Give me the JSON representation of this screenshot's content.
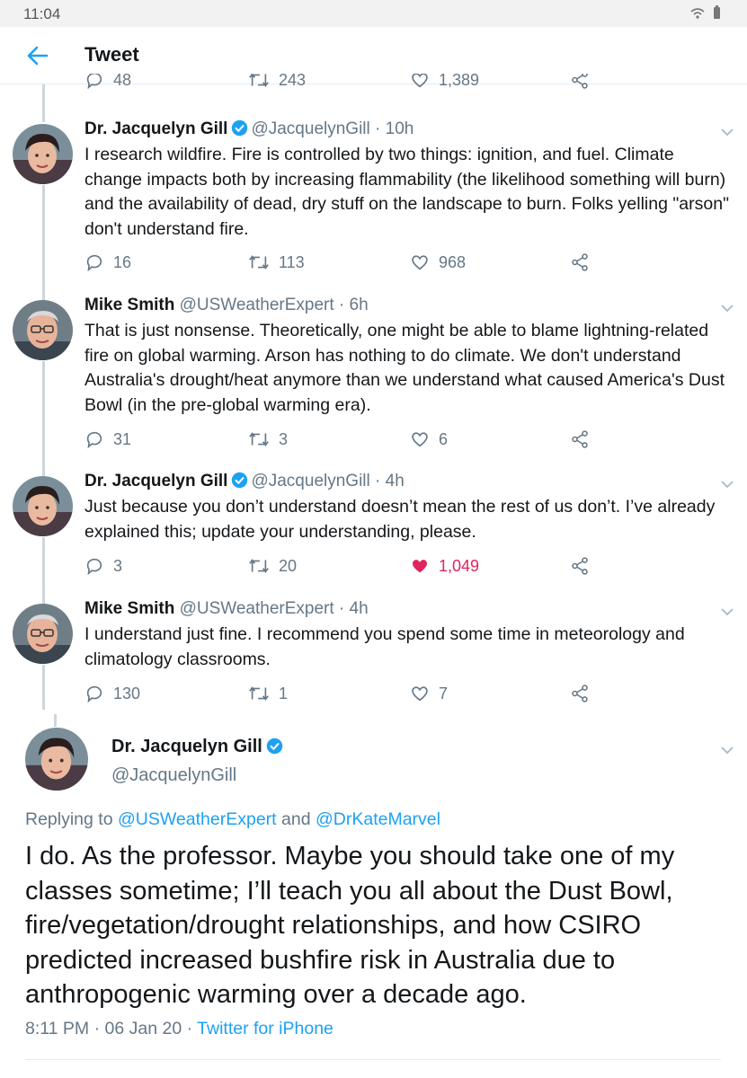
{
  "status_bar": {
    "time": "11:04"
  },
  "app_bar": {
    "title": "Tweet"
  },
  "top_actions": {
    "replies": "48",
    "retweets": "243",
    "likes": "1,389"
  },
  "tweets": [
    {
      "name": "Dr. Jacquelyn Gill",
      "verified": true,
      "meta": "@JacquelynGill · 10h",
      "text": "I research wildfire. Fire is controlled by two things: ignition, and fuel. Climate change impacts both by increasing flammability (the likelihood something will burn) and the availability of dead, dry stuff on the landscape to burn. Folks yelling \"arson\" don't understand fire.",
      "replies": "16",
      "retweets": "113",
      "likes": "968",
      "liked": false
    },
    {
      "name": "Mike Smith",
      "verified": false,
      "meta": "@USWeatherExpert · 6h",
      "text": "That is just nonsense. Theoretically, one might be able to blame lightning-related fire on global warming. Arson has nothing to do climate. We don't understand Australia's drought/heat anymore than we understand what caused America's Dust Bowl (in the pre-global warming era).",
      "replies": "31",
      "retweets": "3",
      "likes": "6",
      "liked": false
    },
    {
      "name": "Dr. Jacquelyn Gill",
      "verified": true,
      "meta": "@JacquelynGill · 4h",
      "text": "Just because you don’t understand doesn’t mean the rest of us don’t. I’ve already explained this; update your understanding, please.",
      "replies": "3",
      "retweets": "20",
      "likes": "1,049",
      "liked": true
    },
    {
      "name": "Mike Smith",
      "verified": false,
      "meta": "@USWeatherExpert · 4h",
      "text": "I understand just fine. I recommend you spend some time in meteorology and climatology classrooms.",
      "replies": "130",
      "retweets": "1",
      "likes": "7",
      "liked": false
    }
  ],
  "main_tweet": {
    "name": "Dr. Jacquelyn Gill",
    "handle": "@JacquelynGill",
    "replying_prefix": "Replying to",
    "reply_to_1": "@USWeatherExpert",
    "reply_and": "and",
    "reply_to_2": "@DrKateMarvel",
    "text": "I do. As the professor. Maybe you should take one of my classes sometime; I’ll teach you all about the Dust Bowl, fire/vegetation/drought relationships, and how CSIRO predicted increased bushfire risk in Australia due to anthropogenic warming over a decade ago.",
    "time": "8:11 PM · 06 Jan 20 ·",
    "source": "Twitter for iPhone"
  },
  "colors": {
    "accent": "#1da1f2",
    "like": "#e0245e",
    "muted": "#657786",
    "text": "#14171a"
  }
}
